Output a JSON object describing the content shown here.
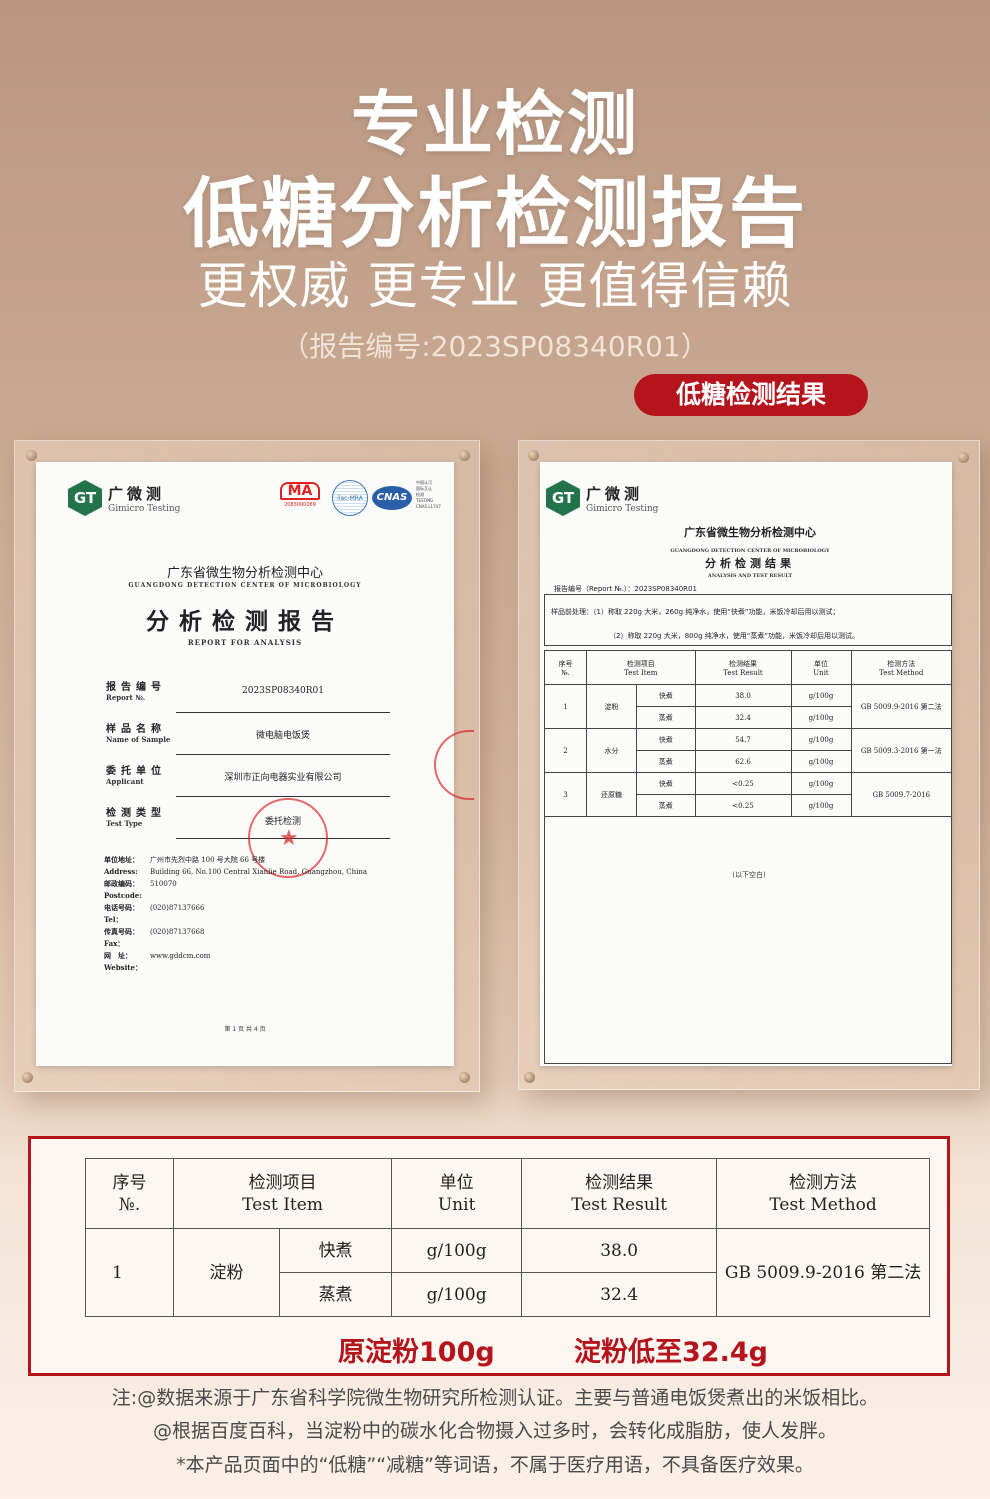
{
  "header": {
    "line1": "专业检测",
    "line2": "低糖分析检测报告",
    "line3": "更权威 更专业 更值得信赖",
    "report_no": "（报告编号:2023SP08340R01）",
    "badge": "低糖检测结果"
  },
  "logo": {
    "mark": "GT",
    "cn": "广微测",
    "en": "Gimicro Testing"
  },
  "left_report": {
    "cert_ma": "MA",
    "cert_ma_no": "2083000089",
    "cert_ilac": "ilac-MRA",
    "cert_cnas": "CNAS",
    "cert_cnas_small": "中国认可\n国际互认\n检测\nTESTING\nCNAS L1747",
    "center_cn": "广东省微生物分析检测中心",
    "center_en": "GUANGDONG DETECTION CENTER OF MICROBIOLOGY",
    "title_cn": "分析检测报告",
    "title_en": "REPORT FOR ANALYSIS",
    "fields": [
      {
        "cn": "报告编号",
        "en": "Report №.",
        "value": "2023SP08340R01"
      },
      {
        "cn": "样品名称",
        "en": "Name of Sample",
        "value": "微电脑电饭煲"
      },
      {
        "cn": "委托单位",
        "en": "Applicant",
        "value": "深圳市正向电器实业有限公司"
      },
      {
        "cn": "检测类型",
        "en": "Test Type",
        "value": "委托检测"
      }
    ],
    "address": [
      {
        "label": "单位地址：",
        "value": "广州市先烈中路 100 号大院 66 号楼"
      },
      {
        "label": "Address:",
        "value": "Building 66, No.100 Central Xianlie Road, Guangzhou, China"
      },
      {
        "label": "邮政编码：",
        "value": "510070"
      },
      {
        "label": "Postcode:",
        "value": ""
      },
      {
        "label": "电话号码：",
        "value": "(020)87137666"
      },
      {
        "label": "Tel：",
        "value": ""
      },
      {
        "label": "传真号码：",
        "value": "(020)87137668"
      },
      {
        "label": "Fax：",
        "value": ""
      },
      {
        "label": "网　址：",
        "value": "www.gddcm.com"
      },
      {
        "label": "Website：",
        "value": ""
      }
    ],
    "page": "第 1 页 共 4 页"
  },
  "right_report": {
    "center_cn": "广东省微生物分析检测中心",
    "center_en": "GUANGDONG DETECTION CENTER OF MICROBIOLOGY",
    "title_cn": "分析检测结果",
    "title_en": "ANALYSIS AND TEST RESULT",
    "report_no": "报告编号（Report №.）：2023SP08340R01",
    "pre1": "样品前处理：（1）称取 220g 大米，260g 纯净水，使用“快煮”功能，米饭冷却后用以测试；",
    "pre2": "（2）称取 220g 大米，800g 纯净水，使用“蒸煮”功能，米饭冷却后用以测试。",
    "headers": [
      [
        "序号",
        "№."
      ],
      [
        "检测项目",
        "Test Item"
      ],
      [
        "检测结果",
        "Test Result"
      ],
      [
        "单位",
        "Unit"
      ],
      [
        "检测方法",
        "Test Method"
      ]
    ],
    "rows": [
      {
        "no": "1",
        "item": "淀粉",
        "method": "GB 5009.9-2016 第二法",
        "sub": [
          {
            "mode": "快煮",
            "result": "38.0",
            "unit": "g/100g"
          },
          {
            "mode": "蒸煮",
            "result": "32.4",
            "unit": "g/100g"
          }
        ]
      },
      {
        "no": "2",
        "item": "水分",
        "method": "GB 5009.3-2016 第一法",
        "sub": [
          {
            "mode": "快煮",
            "result": "54.7",
            "unit": "g/100g"
          },
          {
            "mode": "蒸煮",
            "result": "62.6",
            "unit": "g/100g"
          }
        ]
      },
      {
        "no": "3",
        "item": "还原糖",
        "method": "GB 5009.7-2016",
        "sub": [
          {
            "mode": "快煮",
            "result": "<0.25",
            "unit": "g/100g"
          },
          {
            "mode": "蒸煮",
            "result": "<0.25",
            "unit": "g/100g"
          }
        ]
      }
    ],
    "blank": "(以下空白)"
  },
  "summary_table": {
    "h_no_cn": "序号",
    "h_no_en": "№.",
    "h_item_cn": "检测项目",
    "h_item_en": "Test Item",
    "h_unit_cn": "单位",
    "h_unit_en": "Unit",
    "h_result_cn": "检测结果",
    "h_result_en": "Test Result",
    "h_method_cn": "检测方法",
    "h_method_en": "Test Method",
    "no": "1",
    "item": "淀粉",
    "mode1": "快煮",
    "unit1": "g/100g",
    "result1": "38.0",
    "mode2": "蒸煮",
    "unit2": "g/100g",
    "result2": "32.4",
    "method": "GB 5009.9-2016 第二法"
  },
  "promo": {
    "left": "原淀粉100g",
    "right": "淀粉低至32.4g"
  },
  "notes": [
    "注:@数据来源于广东省科学院微生物研究所检测认证。主要与普通电饭煲煮出的米饭相比。",
    "@根据百度百科，当淀粉中的碳水化合物摄入过多时，会转化成脂肪，使人发胖。",
    "*本产品页面中的“低糖”“减糖”等词语，不属于医疗用语，不具备医疗效果。"
  ],
  "colors": {
    "accent": "#b5141c",
    "logo_green": "#23744a"
  }
}
